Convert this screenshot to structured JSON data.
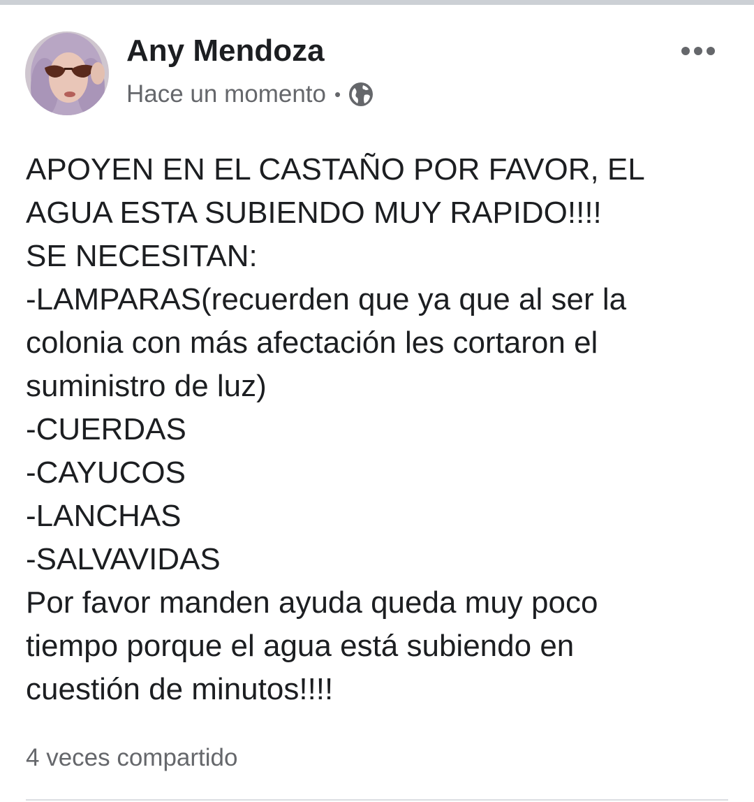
{
  "post": {
    "author_name": "Any Mendoza",
    "timestamp": "Hace un momento",
    "separator": "•",
    "privacy_icon": "globe-icon",
    "more_icon": "more-horizontal-icon",
    "body_lines": [
      "APOYEN EN EL CASTAÑO POR FAVOR, EL",
      "AGUA ESTA SUBIENDO MUY RAPIDO!!!!",
      "SE NECESITAN:",
      "-LAMPARAS(recuerden que ya que al ser la",
      "colonia con más afectación les cortaron el",
      "suministro de luz)",
      "-CUERDAS",
      "-CAYUCOS",
      "-LANCHAS",
      "-SALVAVIDAS",
      "Por favor manden ayuda queda muy poco",
      "tiempo porque el agua está subiendo en",
      "cuestión de minutos!!!!"
    ],
    "share_count_text": "4 veces compartido"
  },
  "colors": {
    "primary_text": "#1c1e21",
    "secondary_text": "#65676b",
    "divider": "#dadde1",
    "top_bar": "#ccd0d5"
  }
}
